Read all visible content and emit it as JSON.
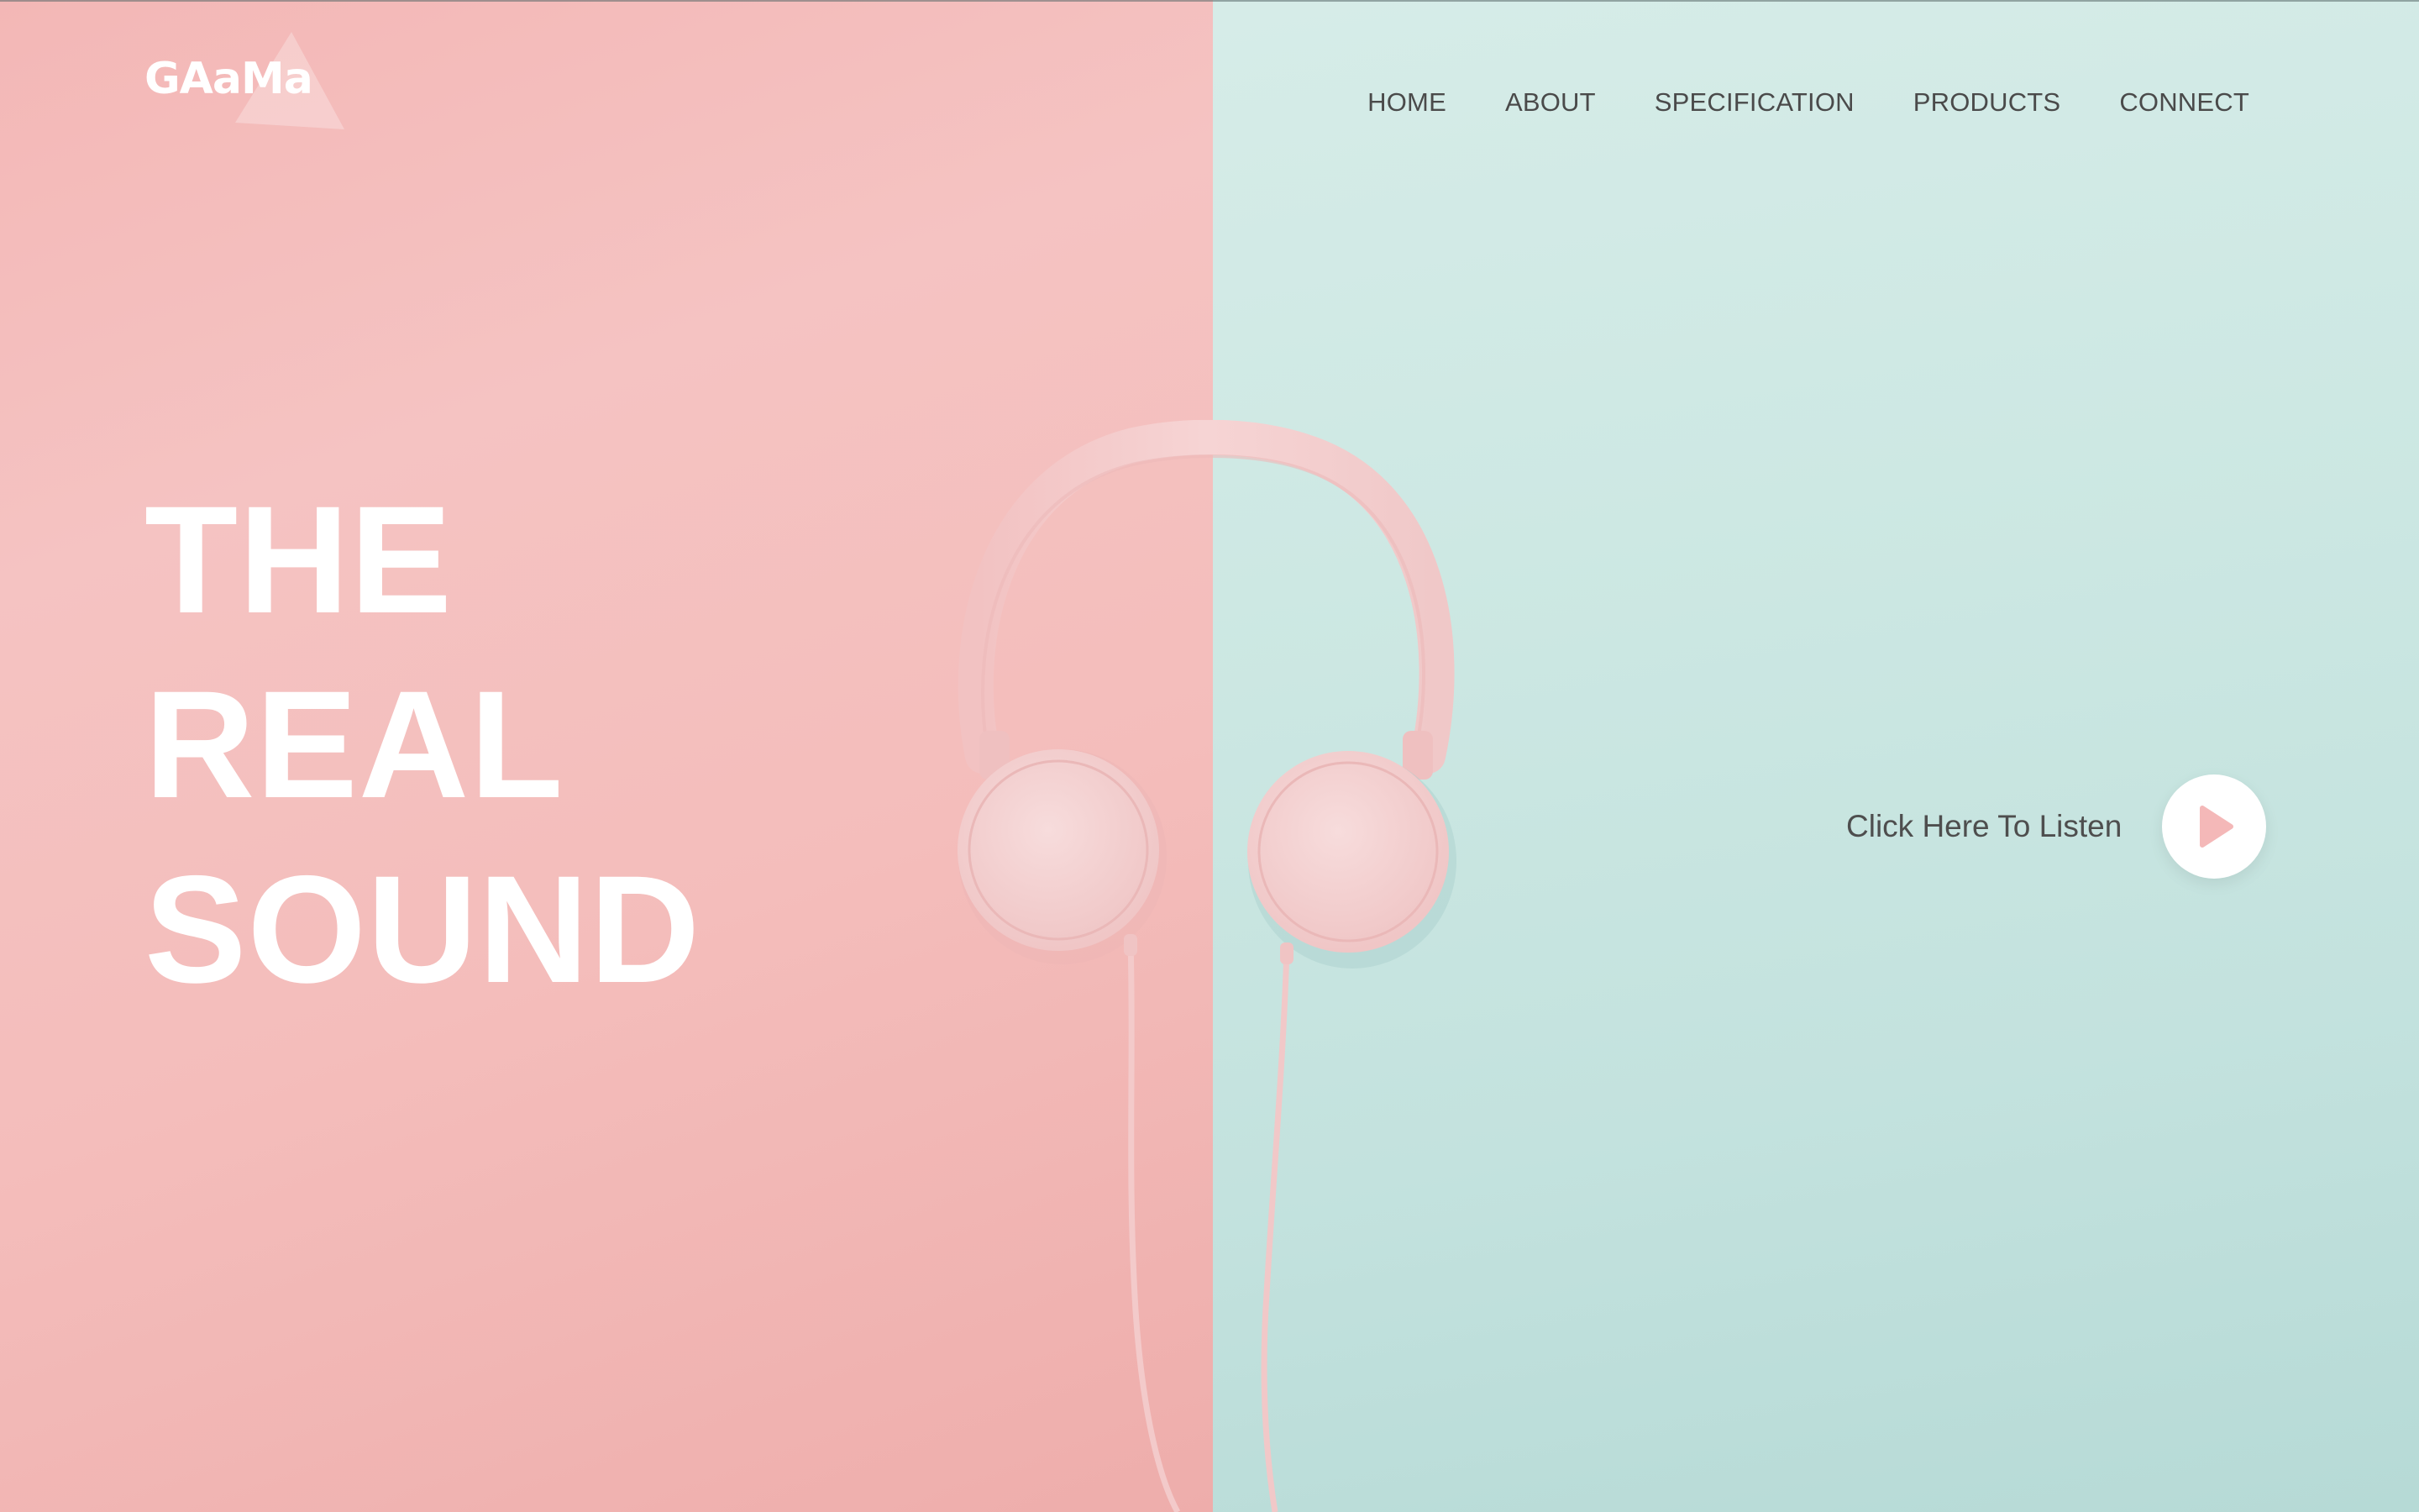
{
  "brand": {
    "logo_text": "GAaMa"
  },
  "nav": {
    "items": [
      "HOME",
      "ABOUT",
      "SPECIFICATION",
      "PRODUCTS",
      "CONNECT"
    ]
  },
  "hero": {
    "headline_lines": [
      "THE",
      "REAL",
      "SOUND"
    ],
    "listen_label": "Click Here To Listen",
    "play_icon": "play-icon"
  },
  "colors": {
    "left_panel": "#f4bdbb",
    "right_panel": "#cde8e3",
    "headphones": "#f5d0d0",
    "play_accent": "#f4b8b8",
    "nav_text": "#4a4a4a",
    "headline_text": "#ffffff"
  }
}
